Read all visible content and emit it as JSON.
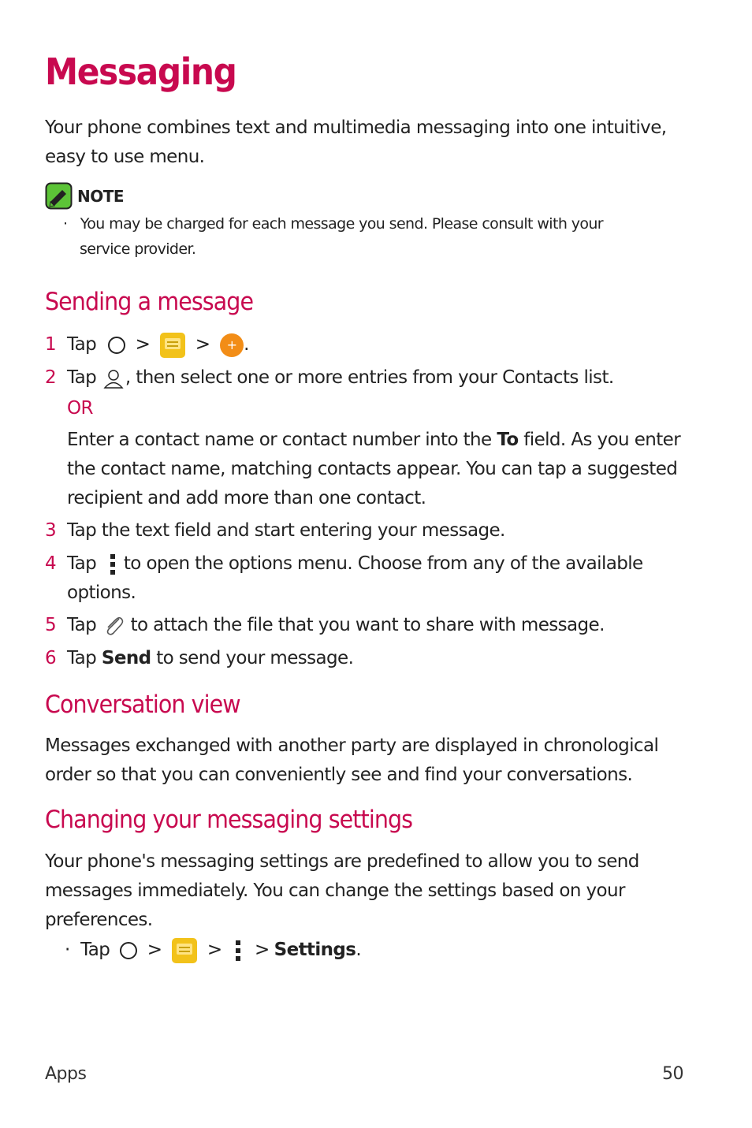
{
  "title": "Messaging",
  "intro": [
    "Your phone combines text and multimedia messaging into one intuitive,",
    "easy to use menu."
  ],
  "note": {
    "label": "NOTE",
    "bullet": "·",
    "lines": [
      "You may be charged for each message you send. Please consult with your",
      "service provider."
    ]
  },
  "sending": {
    "heading": "Sending a message",
    "steps": [
      {
        "num": "1",
        "tap": "Tap",
        "sep": ">",
        "end": "."
      },
      {
        "num": "2",
        "tap": "Tap",
        "text": ", then select one or more entries from your Contacts list."
      },
      {
        "num": "3",
        "text": "Tap the text field and start entering your message."
      },
      {
        "num": "4",
        "tap": "Tap",
        "text": "to open the options menu. Choose from any of the available",
        "text2": "options."
      },
      {
        "num": "5",
        "tap": "Tap",
        "text": "to attach the file that you want to share with message."
      },
      {
        "num": "6",
        "tap": "Tap",
        "bold": "Send",
        "text": "to send your message."
      }
    ],
    "or": "OR",
    "alt_pre": "Enter a contact name or contact number into the",
    "alt_bold": "To",
    "alt_post": "field. As you enter",
    "alt_lines": [
      "the contact name, matching contacts appear. You can tap a suggested",
      "recipient and add more than one contact."
    ]
  },
  "conversation": {
    "heading": "Conversation view",
    "lines": [
      "Messages exchanged with another party are displayed in chronological",
      "order so that you can conveniently see and find your conversations."
    ]
  },
  "settings": {
    "heading": "Changing your messaging settings",
    "lines": [
      "Your phone's messaging settings are predefined to allow you to send",
      "messages immediately. You can change the settings based on your",
      "preferences."
    ],
    "bullet": "·",
    "tap": "Tap",
    "sep": ">",
    "bold": "Settings",
    "end": "."
  },
  "footer": {
    "section": "Apps",
    "page": "50"
  }
}
